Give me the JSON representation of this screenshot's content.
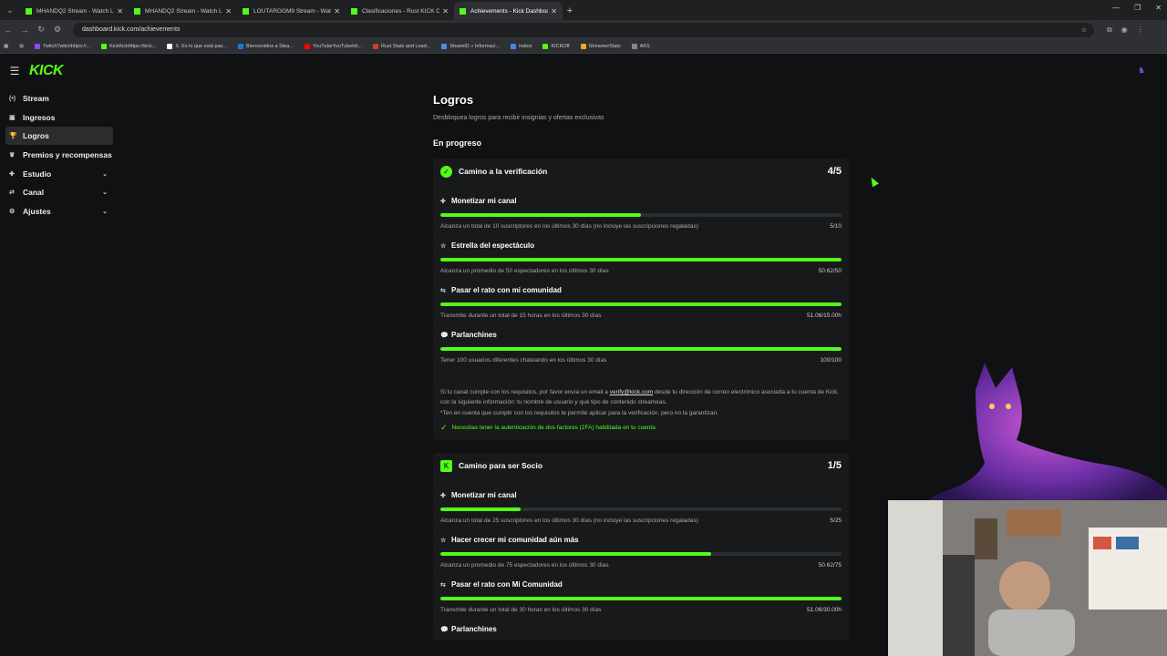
{
  "browser": {
    "tabs": [
      {
        "title": "MHANDQ2 Stream - Watch Live",
        "active": false
      },
      {
        "title": "MHANDQ2 Stream - Watch Live",
        "active": false
      },
      {
        "title": "LOUTAROGM9 Stream - Watch",
        "active": false
      },
      {
        "title": "Clasificaciones - Rust KICK Off",
        "active": false
      },
      {
        "title": "Achievements - Kick Dashboard",
        "active": true
      }
    ],
    "url": "dashboard.kick.com/achievements",
    "bookmarks": [
      {
        "label": "TwitchTwitchhttps://...",
        "color": "#9146ff"
      },
      {
        "label": "KickKickhttps://kick...",
        "color": "#53fc18"
      },
      {
        "label": "X. Es lo que está pas...",
        "color": "#ffffff"
      },
      {
        "label": "Bienvenidos a Stea...",
        "color": "#1b74e4"
      },
      {
        "label": "YouTubeYouTubehtt...",
        "color": "#ff0000"
      },
      {
        "label": "Rust Stats and Lead...",
        "color": "#cd412b"
      },
      {
        "label": "SteamID » Informaci...",
        "color": "#4a90e2"
      },
      {
        "label": "indios",
        "color": "#4285f4"
      },
      {
        "label": "KICKOff",
        "color": "#53fc18"
      },
      {
        "label": "StreamerStats",
        "color": "#f5a623"
      },
      {
        "label": "AKS",
        "color": "#888888"
      }
    ]
  },
  "app": {
    "logo": "KICK",
    "sidebar": [
      {
        "label": "Stream",
        "icon": "stream-icon",
        "glyph": "(•)",
        "active": false,
        "expandable": false
      },
      {
        "label": "Ingresos",
        "icon": "income-icon",
        "glyph": "▣",
        "active": false,
        "expandable": false
      },
      {
        "label": "Logros",
        "icon": "trophy-icon",
        "glyph": "🏆",
        "active": true,
        "expandable": false
      },
      {
        "label": "Premios y recompensas",
        "icon": "gift-icon",
        "glyph": "♛",
        "active": false,
        "expandable": false
      },
      {
        "label": "Estudio",
        "icon": "studio-icon",
        "glyph": "✚",
        "active": false,
        "expandable": true
      },
      {
        "label": "Canal",
        "icon": "channel-icon",
        "glyph": "⇄",
        "active": false,
        "expandable": true
      },
      {
        "label": "Ajustes",
        "icon": "settings-icon",
        "glyph": "⚙",
        "active": false,
        "expandable": true
      }
    ]
  },
  "main": {
    "title": "Logros",
    "subtitle": "Desbloquea logros para recibir insignias y ofertas exclusivas",
    "section": "En progreso",
    "cards": [
      {
        "title": "Camino a la verificación",
        "count": "4/5",
        "badge": "verified-badge-icon",
        "tasks": [
          {
            "title": "Monetizar mi canal",
            "desc": "Alcanza un total de 10 suscriptores en los últimos 30 días (no incluye las suscripciones regaladas)",
            "value": "5/10",
            "progress": 0.5
          },
          {
            "title": "Estrella del espectáculo",
            "desc": "Alcanza un promedio de 50 espectadores en los últimos 30 días",
            "value": "50.62/50",
            "progress": 1.0
          },
          {
            "title": "Pasar el rato con mi comunidad",
            "desc": "Transmite durante un total de 15 horas en los últimos 30 días",
            "value": "51.06/15.00h",
            "progress": 1.0
          },
          {
            "title": "Parlanchines",
            "desc": "Tener 100 usuarios diferentes chateando en los últimos 30 días",
            "value": "100/100",
            "progress": 1.0
          }
        ],
        "note_pre": "Si tu canal cumple con los requisitos, por favor envía un email a ",
        "note_link": "verify@kick.com",
        "note_post": " desde tu dirección de correo electrónico asociada a tu cuenta de Kick, con la siguiente información: tu nombre de usuario y qué tipo de contenido streameas.",
        "note2": "*Ten en cuenta que cumplir con los requisitos te permite aplicar para la verificación, pero no la garantizan.",
        "ok": "Necesitas tener la autenticación de dos factores (2FA) habilitada en tu cuenta"
      },
      {
        "title": "Camino para ser Socio",
        "count": "1/5",
        "badge": "kick-badge-icon",
        "tasks": [
          {
            "title": "Monetizar mi canal",
            "desc": "Alcanza un total de 25 suscriptores en los últimos 30 días (no incluye las suscripciones regaladas)",
            "value": "5/25",
            "progress": 0.2
          },
          {
            "title": "Hacer crecer mi comunidad aún más",
            "desc": "Alcanza un promedio de 75 espectadores en los últimos 30 días",
            "value": "50.62/75",
            "progress": 0.675
          },
          {
            "title": "Pasar el rato con Mi Comunidad",
            "desc": "Transmite durante un total de 30 horas en los últimos 30 días",
            "value": "51.06/30.00h",
            "progress": 1.0
          },
          {
            "title": "Parlanchines",
            "desc": "",
            "value": "",
            "progress": 0
          }
        ]
      }
    ]
  }
}
